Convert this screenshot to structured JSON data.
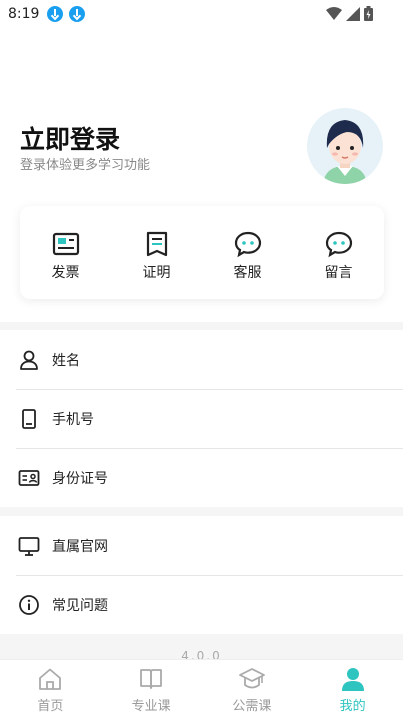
{
  "status_bar": {
    "time": "8:19"
  },
  "header": {
    "login_title": "立即登录",
    "login_subtitle": "登录体验更多学习功能"
  },
  "quick_actions": [
    {
      "label": "发票",
      "icon": "invoice-icon"
    },
    {
      "label": "证明",
      "icon": "certificate-icon"
    },
    {
      "label": "客服",
      "icon": "chat-icon"
    },
    {
      "label": "留言",
      "icon": "message-icon"
    }
  ],
  "profile_list": [
    {
      "label": "姓名",
      "icon": "person-icon"
    },
    {
      "label": "手机号",
      "icon": "phone-icon"
    },
    {
      "label": "身份证号",
      "icon": "id-card-icon"
    }
  ],
  "info_list": [
    {
      "label": "直属官网",
      "icon": "monitor-icon"
    },
    {
      "label": "常见问题",
      "icon": "info-icon"
    }
  ],
  "version": "4.0.0",
  "tabbar": {
    "tabs": [
      {
        "label": "首页",
        "icon": "home-icon",
        "active": false
      },
      {
        "label": "专业课",
        "icon": "book-icon",
        "active": false
      },
      {
        "label": "公需课",
        "icon": "graduation-cap-icon",
        "active": false
      },
      {
        "label": "我的",
        "icon": "user-icon",
        "active": true
      }
    ]
  },
  "colors": {
    "accent": "#2ec4c0",
    "download": "#1a9ff0"
  }
}
